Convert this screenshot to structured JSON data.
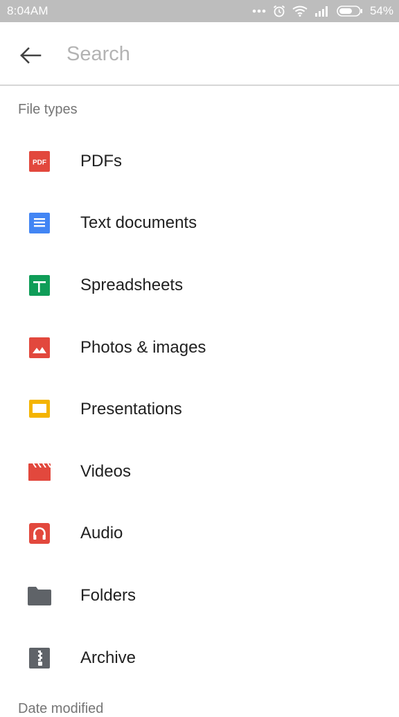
{
  "status_bar": {
    "time": "8:04AM",
    "battery": "54%",
    "icons": [
      "more-dots-icon",
      "alarm-icon",
      "wifi-icon",
      "signal-icon",
      "battery-icon"
    ]
  },
  "search": {
    "placeholder": "Search",
    "value": ""
  },
  "section": {
    "title": "File types",
    "next_title": "Date modified"
  },
  "file_types": [
    {
      "label": "PDFs",
      "icon": "pdf-icon",
      "color": "#e2483d"
    },
    {
      "label": "Text documents",
      "icon": "doc-icon",
      "color": "#4285f4"
    },
    {
      "label": "Spreadsheets",
      "icon": "sheet-icon",
      "color": "#0f9d58"
    },
    {
      "label": "Photos & images",
      "icon": "image-icon",
      "color": "#e2483d"
    },
    {
      "label": "Presentations",
      "icon": "slides-icon",
      "color": "#f4b400"
    },
    {
      "label": "Videos",
      "icon": "video-icon",
      "color": "#e2483d"
    },
    {
      "label": "Audio",
      "icon": "audio-icon",
      "color": "#e2483d"
    },
    {
      "label": "Folders",
      "icon": "folder-icon",
      "color": "#5f6368"
    },
    {
      "label": "Archive",
      "icon": "archive-icon",
      "color": "#5f6368"
    }
  ],
  "pdf_icon_text": "PDF"
}
